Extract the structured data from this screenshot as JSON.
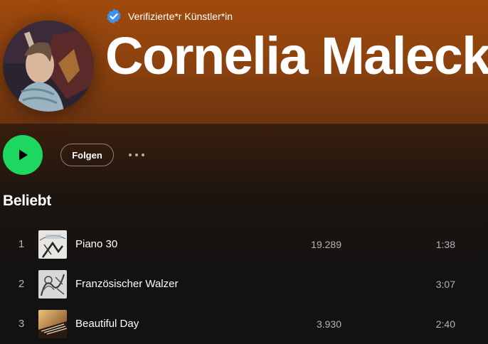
{
  "artist": {
    "verified_label": "Verifizierte*r Künstler*in",
    "name": "Cornelia Malecki",
    "icons": {
      "verified": "verified-badge-icon",
      "avatar": "artist-photo"
    }
  },
  "colors": {
    "accent": "#1ed760",
    "verified": "#3d91f4",
    "hero": "#9a4710",
    "background": "#121212"
  },
  "actions": {
    "play_icon": "play-icon",
    "follow_label": "Folgen",
    "more_icon": "more-options-icon"
  },
  "popular": {
    "title": "Beliebt",
    "tracks": [
      {
        "number": "1",
        "title": "Piano 30",
        "plays": "19.289",
        "duration": "1:38"
      },
      {
        "number": "2",
        "title": "Französischer Walzer",
        "plays": "",
        "duration": "3:07"
      },
      {
        "number": "3",
        "title": "Beautiful Day",
        "plays": "3.930",
        "duration": "2:40"
      }
    ]
  }
}
